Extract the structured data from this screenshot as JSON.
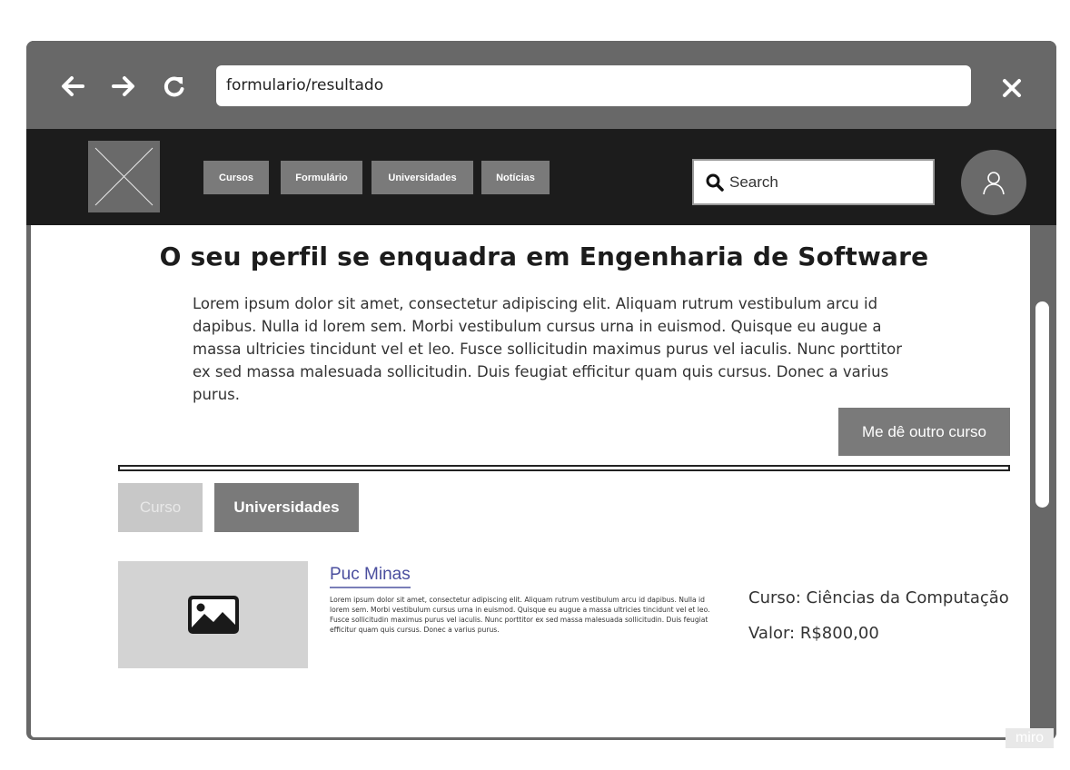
{
  "browser": {
    "url": "formulario/resultado"
  },
  "navbar": {
    "menu": [
      "Cursos",
      "Formulário",
      "Universidades",
      "Notícias"
    ],
    "search_placeholder": "Search"
  },
  "main": {
    "title": "O seu perfil se enquadra em Engenharia de Software",
    "intro": "Lorem ipsum dolor sit amet, consectetur adipiscing elit. Aliquam rutrum vestibulum arcu id dapibus. Nulla id lorem sem. Morbi vestibulum cursus urna in euismod. Quisque eu augue a massa ultricies tincidunt vel et leo. Fusce sollicitudin maximus purus vel iaculis. Nunc porttitor ex sed massa malesuada sollicitudin. Duis feugiat efficitur quam quis cursus. Donec a varius purus.",
    "another_course_button": "Me dê outro curso",
    "tabs": [
      "Curso",
      "Universidades"
    ]
  },
  "university_card": {
    "name": "Puc Minas",
    "description": "Lorem ipsum dolor sit amet, consectetur adipiscing elit. Aliquam rutrum vestibulum arcu id dapibus. Nulla id lorem sem. Morbi vestibulum cursus urna in euismod. Quisque eu augue a massa ultricies tincidunt vel et leo. Fusce sollicitudin maximus purus vel iaculis. Nunc porttitor ex sed massa malesuada sollicitudin. Duis feugiat efficitur quam quis cursus. Donec a varius purus.",
    "course": "Curso: Ciências da Computação",
    "price": "Valor: R$800,00"
  },
  "watermark": "miro",
  "icons": {
    "back": "arrow-left-icon",
    "forward": "arrow-right-icon",
    "reload": "reload-icon",
    "close": "close-icon",
    "search": "search-icon",
    "user": "user-icon",
    "image": "image-placeholder-icon"
  },
  "colors": {
    "chrome": "#686868",
    "navbar": "#1c1c1c",
    "button": "#7a7a7a",
    "link": "#4a4e9e"
  }
}
